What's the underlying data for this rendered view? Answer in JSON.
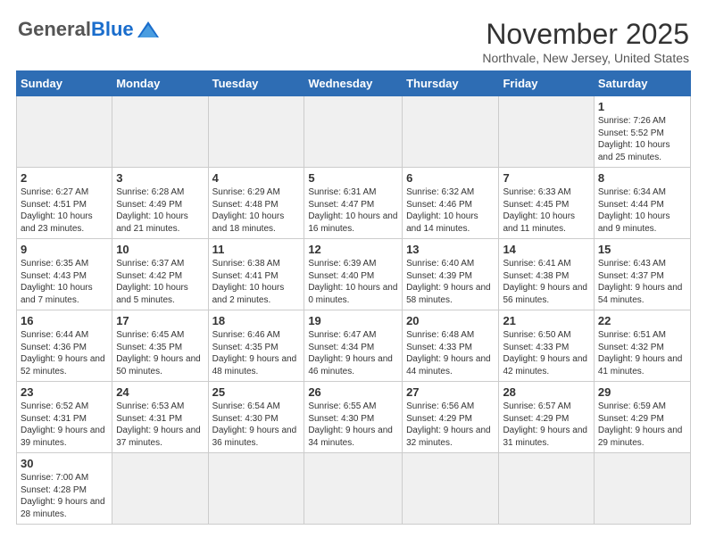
{
  "header": {
    "logo_general": "General",
    "logo_blue": "Blue",
    "month_title": "November 2025",
    "location": "Northvale, New Jersey, United States"
  },
  "days_of_week": [
    "Sunday",
    "Monday",
    "Tuesday",
    "Wednesday",
    "Thursday",
    "Friday",
    "Saturday"
  ],
  "weeks": [
    [
      {
        "day": "",
        "info": "",
        "empty": true
      },
      {
        "day": "",
        "info": "",
        "empty": true
      },
      {
        "day": "",
        "info": "",
        "empty": true
      },
      {
        "day": "",
        "info": "",
        "empty": true
      },
      {
        "day": "",
        "info": "",
        "empty": true
      },
      {
        "day": "",
        "info": "",
        "empty": true
      },
      {
        "day": "1",
        "info": "Sunrise: 7:26 AM\nSunset: 5:52 PM\nDaylight: 10 hours and 25 minutes.",
        "empty": false
      }
    ],
    [
      {
        "day": "2",
        "info": "Sunrise: 6:27 AM\nSunset: 4:51 PM\nDaylight: 10 hours and 23 minutes.",
        "empty": false
      },
      {
        "day": "3",
        "info": "Sunrise: 6:28 AM\nSunset: 4:49 PM\nDaylight: 10 hours and 21 minutes.",
        "empty": false
      },
      {
        "day": "4",
        "info": "Sunrise: 6:29 AM\nSunset: 4:48 PM\nDaylight: 10 hours and 18 minutes.",
        "empty": false
      },
      {
        "day": "5",
        "info": "Sunrise: 6:31 AM\nSunset: 4:47 PM\nDaylight: 10 hours and 16 minutes.",
        "empty": false
      },
      {
        "day": "6",
        "info": "Sunrise: 6:32 AM\nSunset: 4:46 PM\nDaylight: 10 hours and 14 minutes.",
        "empty": false
      },
      {
        "day": "7",
        "info": "Sunrise: 6:33 AM\nSunset: 4:45 PM\nDaylight: 10 hours and 11 minutes.",
        "empty": false
      },
      {
        "day": "8",
        "info": "Sunrise: 6:34 AM\nSunset: 4:44 PM\nDaylight: 10 hours and 9 minutes.",
        "empty": false
      }
    ],
    [
      {
        "day": "9",
        "info": "Sunrise: 6:35 AM\nSunset: 4:43 PM\nDaylight: 10 hours and 7 minutes.",
        "empty": false
      },
      {
        "day": "10",
        "info": "Sunrise: 6:37 AM\nSunset: 4:42 PM\nDaylight: 10 hours and 5 minutes.",
        "empty": false
      },
      {
        "day": "11",
        "info": "Sunrise: 6:38 AM\nSunset: 4:41 PM\nDaylight: 10 hours and 2 minutes.",
        "empty": false
      },
      {
        "day": "12",
        "info": "Sunrise: 6:39 AM\nSunset: 4:40 PM\nDaylight: 10 hours and 0 minutes.",
        "empty": false
      },
      {
        "day": "13",
        "info": "Sunrise: 6:40 AM\nSunset: 4:39 PM\nDaylight: 9 hours and 58 minutes.",
        "empty": false
      },
      {
        "day": "14",
        "info": "Sunrise: 6:41 AM\nSunset: 4:38 PM\nDaylight: 9 hours and 56 minutes.",
        "empty": false
      },
      {
        "day": "15",
        "info": "Sunrise: 6:43 AM\nSunset: 4:37 PM\nDaylight: 9 hours and 54 minutes.",
        "empty": false
      }
    ],
    [
      {
        "day": "16",
        "info": "Sunrise: 6:44 AM\nSunset: 4:36 PM\nDaylight: 9 hours and 52 minutes.",
        "empty": false
      },
      {
        "day": "17",
        "info": "Sunrise: 6:45 AM\nSunset: 4:35 PM\nDaylight: 9 hours and 50 minutes.",
        "empty": false
      },
      {
        "day": "18",
        "info": "Sunrise: 6:46 AM\nSunset: 4:35 PM\nDaylight: 9 hours and 48 minutes.",
        "empty": false
      },
      {
        "day": "19",
        "info": "Sunrise: 6:47 AM\nSunset: 4:34 PM\nDaylight: 9 hours and 46 minutes.",
        "empty": false
      },
      {
        "day": "20",
        "info": "Sunrise: 6:48 AM\nSunset: 4:33 PM\nDaylight: 9 hours and 44 minutes.",
        "empty": false
      },
      {
        "day": "21",
        "info": "Sunrise: 6:50 AM\nSunset: 4:33 PM\nDaylight: 9 hours and 42 minutes.",
        "empty": false
      },
      {
        "day": "22",
        "info": "Sunrise: 6:51 AM\nSunset: 4:32 PM\nDaylight: 9 hours and 41 minutes.",
        "empty": false
      }
    ],
    [
      {
        "day": "23",
        "info": "Sunrise: 6:52 AM\nSunset: 4:31 PM\nDaylight: 9 hours and 39 minutes.",
        "empty": false
      },
      {
        "day": "24",
        "info": "Sunrise: 6:53 AM\nSunset: 4:31 PM\nDaylight: 9 hours and 37 minutes.",
        "empty": false
      },
      {
        "day": "25",
        "info": "Sunrise: 6:54 AM\nSunset: 4:30 PM\nDaylight: 9 hours and 36 minutes.",
        "empty": false
      },
      {
        "day": "26",
        "info": "Sunrise: 6:55 AM\nSunset: 4:30 PM\nDaylight: 9 hours and 34 minutes.",
        "empty": false
      },
      {
        "day": "27",
        "info": "Sunrise: 6:56 AM\nSunset: 4:29 PM\nDaylight: 9 hours and 32 minutes.",
        "empty": false
      },
      {
        "day": "28",
        "info": "Sunrise: 6:57 AM\nSunset: 4:29 PM\nDaylight: 9 hours and 31 minutes.",
        "empty": false
      },
      {
        "day": "29",
        "info": "Sunrise: 6:59 AM\nSunset: 4:29 PM\nDaylight: 9 hours and 29 minutes.",
        "empty": false
      }
    ],
    [
      {
        "day": "30",
        "info": "Sunrise: 7:00 AM\nSunset: 4:28 PM\nDaylight: 9 hours and 28 minutes.",
        "empty": false
      },
      {
        "day": "",
        "info": "",
        "empty": true
      },
      {
        "day": "",
        "info": "",
        "empty": true
      },
      {
        "day": "",
        "info": "",
        "empty": true
      },
      {
        "day": "",
        "info": "",
        "empty": true
      },
      {
        "day": "",
        "info": "",
        "empty": true
      },
      {
        "day": "",
        "info": "",
        "empty": true
      }
    ]
  ]
}
